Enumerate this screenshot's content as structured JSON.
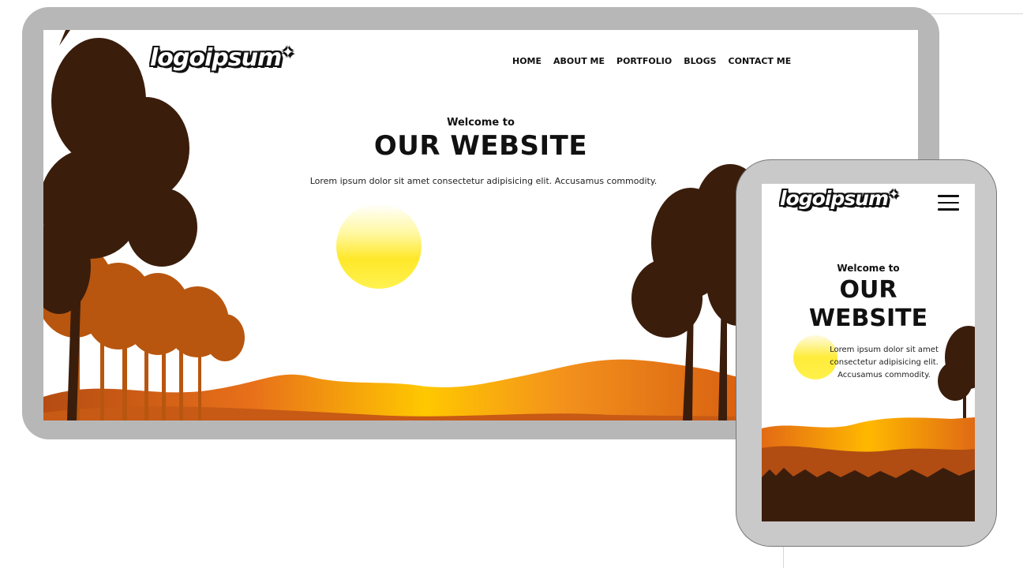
{
  "brand": {
    "logo_text": "logoipsum"
  },
  "nav": {
    "items": [
      "HOME",
      "ABOUT ME",
      "PORTFOLIO",
      "BLOGS",
      "CONTACT ME"
    ]
  },
  "hero": {
    "welcome": "Welcome to",
    "title": "OUR WEBSITE",
    "description": "Lorem ipsum dolor sit amet consectetur adipisicing elit. Accusamus commodity."
  },
  "mobile": {
    "welcome": "Welcome to",
    "title_line1": "OUR",
    "title_line2": "WEBSITE",
    "description": "Lorem ipsum dolor sit amet consectetur adipisicing elit. Accusamus commodity.",
    "menu_icon": "hamburger-menu-icon"
  },
  "colors": {
    "device_frame": "#b7b7b7",
    "phone_frame": "#c9c9c9",
    "tree_dark": "#3b1d0c",
    "tree_orange": "#b8560f",
    "hills_orange": "#e86f1a",
    "sun_yellow": "#fff23a"
  }
}
